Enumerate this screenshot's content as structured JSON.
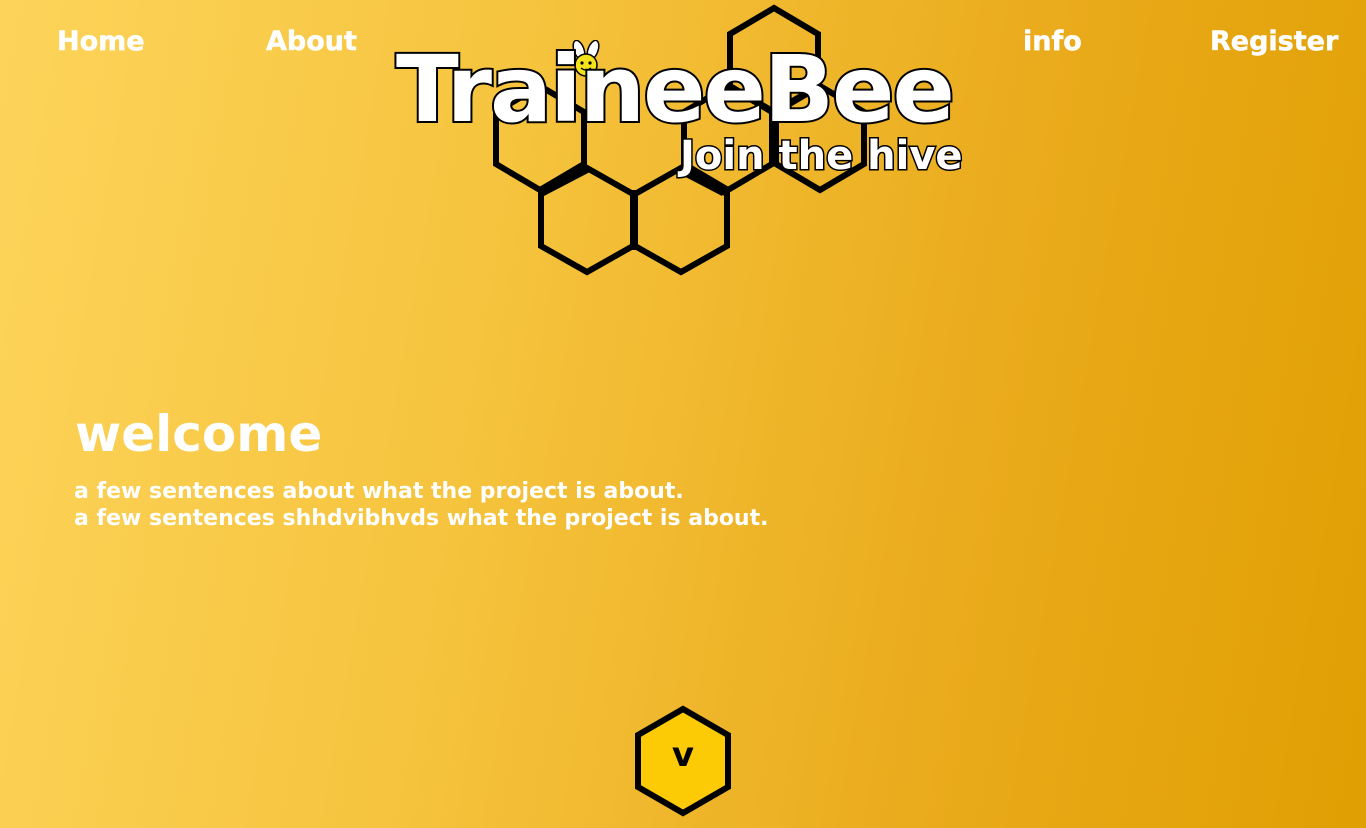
{
  "nav": {
    "home_label": "Home",
    "about_label": "About",
    "info_label": "info",
    "register_label": "Register"
  },
  "logo": {
    "title": "TraineeBee",
    "tagline": "Join the hive",
    "icon": "bee-icon"
  },
  "hero": {
    "heading": "welcome",
    "line_1": "a few sentences about what the project is about.",
    "line_2": "a few sentences shhdvibhvds what the project is about."
  },
  "scroll_button": {
    "label": "v",
    "icon": "hexagon-down-icon"
  },
  "colors": {
    "gradient_start": "#fdd45a",
    "gradient_end": "#e09f02",
    "text": "#ffffff",
    "outline": "#000000",
    "button_fill": "#fccb05"
  }
}
